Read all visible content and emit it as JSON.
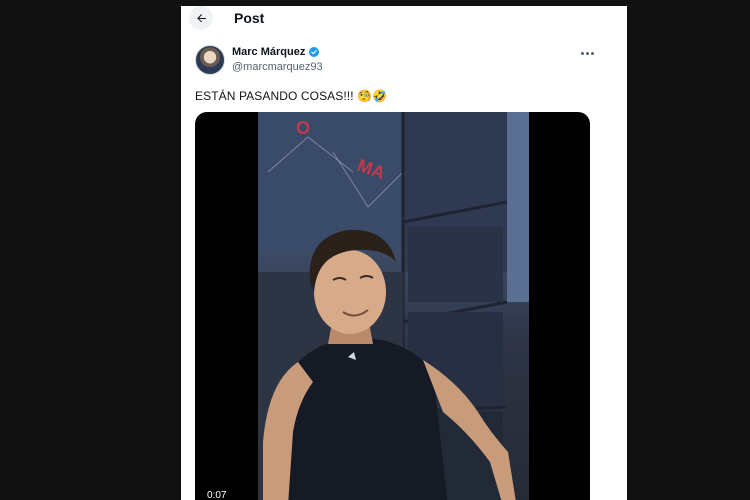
{
  "header": {
    "title": "Post"
  },
  "author": {
    "name": "Marc Márquez",
    "handle": "@marcmarquez93"
  },
  "tweet": {
    "text": "ESTÁN PASANDO COSAS!!!",
    "emojis": "🧐🤣"
  },
  "video": {
    "timestamp": "0:07"
  },
  "colors": {
    "accent": "#1d9bf0",
    "panel_bg": "#ffffff",
    "page_bg": "#111111"
  },
  "icons": {
    "back": "arrow-left-icon",
    "verified": "verified-badge-icon",
    "more": "more-dots-icon"
  }
}
